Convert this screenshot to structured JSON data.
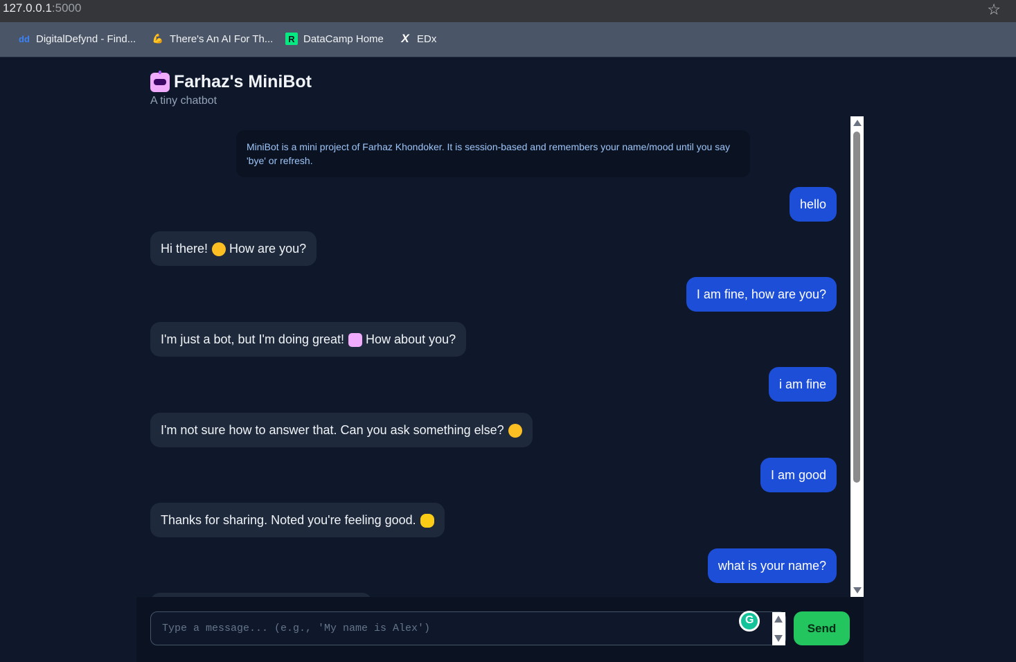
{
  "browser": {
    "url_host": "127.0.0.1",
    "url_port": ":5000",
    "bookmarks": [
      {
        "label": "DigitalDefynd - Find...",
        "icon": "dd-icon"
      },
      {
        "label": "There's An AI For Th...",
        "icon": "arm-icon"
      },
      {
        "label": "DataCamp Home",
        "icon": "datacamp-icon"
      },
      {
        "label": "EDx",
        "icon": "x-icon"
      }
    ]
  },
  "app": {
    "title": "Farhaz's MiniBot",
    "subtitle": "A tiny chatbot"
  },
  "chat": {
    "notice": "MiniBot is a mini project of Farhaz Khondoker. It is session-based and remembers your name/mood until you say 'bye' or refresh.",
    "messages": [
      {
        "role": "user",
        "text": "hello"
      },
      {
        "role": "bot",
        "text": "Hi there!",
        "text2": "How are you?",
        "emoji": "smiling-face"
      },
      {
        "role": "user",
        "text": "I am fine, how are you?"
      },
      {
        "role": "bot",
        "text": "I'm just a bot, but I'm doing great!",
        "text2": "How about you?",
        "emoji": "robot-face"
      },
      {
        "role": "user",
        "text": "i am fine"
      },
      {
        "role": "bot",
        "text": "I'm not sure how to answer that. Can you ask something else?",
        "emoji": "thinking-face"
      },
      {
        "role": "user",
        "text": "I am good"
      },
      {
        "role": "bot",
        "text": "Thanks for sharing. Noted you're feeling good.",
        "emoji": "sun"
      },
      {
        "role": "user",
        "text": "what is your name?"
      }
    ]
  },
  "composer": {
    "placeholder": "Type a message... (e.g., 'My name is Alex')",
    "send_label": "Send"
  },
  "colors": {
    "background": "#0f172a",
    "user_bubble": "#1d4ed8",
    "bot_bubble": "#1e293b",
    "send_button": "#22c55e"
  }
}
